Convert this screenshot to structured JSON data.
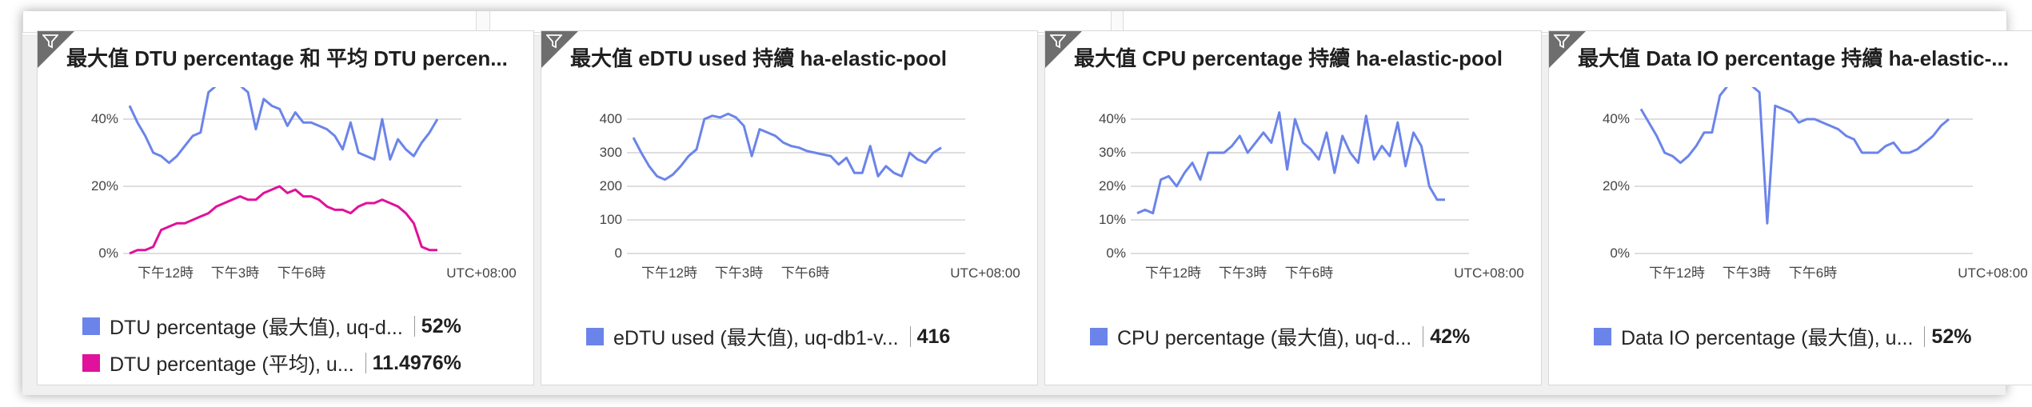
{
  "colors": {
    "blue": "#6b84ea",
    "magenta": "#e0119a"
  },
  "tiles": [
    {
      "title": "最大值 DTU percentage 和 平均 DTU percen...",
      "yticks": [
        "40%",
        "20%",
        "0%"
      ],
      "xticks": [
        "下午12時",
        "下午3時",
        "下午6時",
        "UTC+08:00"
      ],
      "legend": [
        {
          "label": "DTU percentage (最大值), uq-d...",
          "value": "52%",
          "color": "#6b84ea"
        },
        {
          "label": "DTU percentage (平均), u...",
          "value": "11.4976%",
          "color": "#e0119a"
        }
      ]
    },
    {
      "title": "最大值 eDTU used 持續 ha-elastic-pool",
      "yticks": [
        "400",
        "300",
        "200",
        "100",
        "0"
      ],
      "xticks": [
        "下午12時",
        "下午3時",
        "下午6時",
        "UTC+08:00"
      ],
      "legend": [
        {
          "label": "eDTU used (最大值), uq-db1-v...",
          "value": "416",
          "color": "#6b84ea"
        }
      ]
    },
    {
      "title": "最大值 CPU percentage 持續 ha-elastic-pool",
      "yticks": [
        "40%",
        "30%",
        "20%",
        "10%",
        "0%"
      ],
      "xticks": [
        "下午12時",
        "下午3時",
        "下午6時",
        "UTC+08:00"
      ],
      "legend": [
        {
          "label": "CPU percentage (最大值), uq-d...",
          "value": "42%",
          "color": "#6b84ea"
        }
      ]
    },
    {
      "title": "最大值 Data IO percentage 持續 ha-elastic-...",
      "yticks": [
        "40%",
        "20%",
        "0%"
      ],
      "xticks": [
        "下午12時",
        "下午3時",
        "下午6時",
        "UTC+08:00"
      ],
      "legend": [
        {
          "label": "Data IO percentage (最大值), u...",
          "value": "52%",
          "color": "#6b84ea"
        }
      ]
    }
  ],
  "chart_data": [
    {
      "type": "line",
      "title": "最大值 DTU percentage 和 平均 DTU percen...",
      "ylim": [
        0,
        55
      ],
      "series": [
        {
          "name": "DTU percentage (最大值), uq-d...",
          "values": [
            44,
            39,
            35,
            30,
            29,
            27,
            29,
            32,
            35,
            36,
            48,
            50,
            50,
            52,
            50,
            48,
            37,
            46,
            44,
            43,
            38,
            42,
            39,
            39,
            38,
            37,
            35,
            31,
            39,
            30,
            29,
            28,
            40,
            28,
            34,
            31,
            29,
            33,
            36,
            40
          ]
        },
        {
          "name": "DTU percentage (平均), u...",
          "values": [
            0,
            1,
            1,
            2,
            7,
            8,
            9,
            9,
            10,
            11,
            12,
            14,
            15,
            16,
            17,
            16,
            16,
            18,
            19,
            20,
            18,
            19,
            17,
            17,
            16,
            14,
            13,
            13,
            12,
            14,
            15,
            15,
            16,
            15,
            14,
            12,
            9,
            2,
            1,
            1
          ]
        }
      ]
    },
    {
      "type": "line",
      "title": "最大值 eDTU used 持續 ha-elastic-pool",
      "ylim": [
        0,
        420
      ],
      "series": [
        {
          "name": "eDTU used (最大值), uq-db1-v...",
          "values": [
            345,
            300,
            260,
            230,
            220,
            235,
            260,
            290,
            310,
            400,
            410,
            405,
            416,
            405,
            380,
            290,
            370,
            360,
            350,
            330,
            320,
            315,
            305,
            300,
            295,
            290,
            265,
            285,
            240,
            240,
            320,
            230,
            260,
            240,
            230,
            300,
            280,
            270,
            300,
            315
          ]
        }
      ]
    },
    {
      "type": "line",
      "title": "最大值 CPU percentage 持續 ha-elastic-pool",
      "ylim": [
        0,
        43
      ],
      "series": [
        {
          "name": "CPU percentage (最大值), uq-d...",
          "values": [
            12,
            13,
            12,
            22,
            23,
            20,
            24,
            27,
            22,
            30,
            30,
            30,
            32,
            35,
            30,
            33,
            36,
            33,
            42,
            25,
            40,
            33,
            31,
            28,
            36,
            24,
            35,
            30,
            27,
            41,
            28,
            32,
            29,
            39,
            26,
            36,
            32,
            20,
            16,
            16
          ]
        }
      ]
    },
    {
      "type": "line",
      "title": "最大值 Data IO percentage 持續 ha-elastic-...",
      "ylim": [
        0,
        55
      ],
      "series": [
        {
          "name": "Data IO percentage (最大值), u...",
          "values": [
            43,
            39,
            35,
            30,
            29,
            27,
            29,
            32,
            36,
            36,
            47,
            50,
            50,
            51,
            50,
            48,
            9,
            44,
            43,
            42,
            39,
            40,
            40,
            39,
            38,
            37,
            35,
            34,
            30,
            30,
            30,
            32,
            33,
            30,
            30,
            31,
            33,
            35,
            38,
            40
          ]
        }
      ]
    }
  ]
}
